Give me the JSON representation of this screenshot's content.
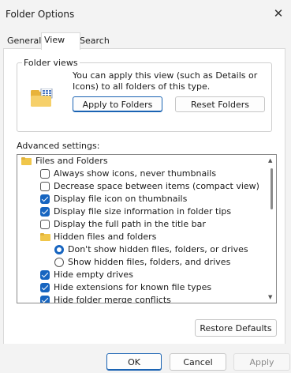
{
  "window": {
    "title": "Folder Options",
    "close_icon": "close-icon"
  },
  "tabs": [
    {
      "label": "General",
      "selected": false
    },
    {
      "label": "View",
      "selected": true
    },
    {
      "label": "Search",
      "selected": false
    }
  ],
  "folder_views": {
    "legend": "Folder views",
    "description": "You can apply this view (such as Details or Icons) to all folders of this type.",
    "apply_button": "Apply to Folders",
    "reset_button": "Reset Folders"
  },
  "advanced": {
    "label": "Advanced settings:",
    "items": [
      {
        "type": "folder",
        "label": "Files and Folders"
      },
      {
        "type": "checkbox",
        "label": "Always show icons, never thumbnails",
        "checked": false
      },
      {
        "type": "checkbox",
        "label": "Decrease space between items (compact view)",
        "checked": false
      },
      {
        "type": "checkbox",
        "label": "Display file icon on thumbnails",
        "checked": true
      },
      {
        "type": "checkbox",
        "label": "Display file size information in folder tips",
        "checked": true
      },
      {
        "type": "checkbox",
        "label": "Display the full path in the title bar",
        "checked": false
      },
      {
        "type": "folder",
        "label": "Hidden files and folders"
      },
      {
        "type": "radio",
        "label": "Don't show hidden files, folders, or drives",
        "checked": true
      },
      {
        "type": "radio",
        "label": "Show hidden files, folders, and drives",
        "checked": false
      },
      {
        "type": "checkbox",
        "label": "Hide empty drives",
        "checked": true
      },
      {
        "type": "checkbox",
        "label": "Hide extensions for known file types",
        "checked": true
      },
      {
        "type": "checkbox",
        "label": "Hide folder merge conflicts",
        "checked": true
      }
    ],
    "restore_button": "Restore Defaults"
  },
  "footer": {
    "ok": "OK",
    "cancel": "Cancel",
    "apply": "Apply"
  },
  "colors": {
    "accent": "#1765c0",
    "folder": "#f0c64a"
  }
}
